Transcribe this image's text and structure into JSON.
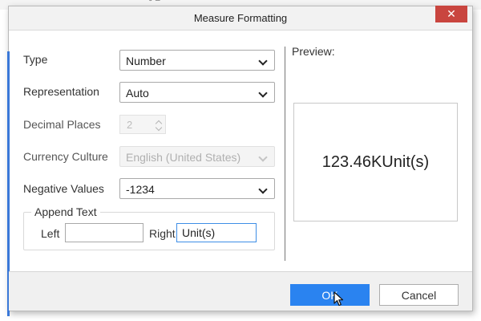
{
  "background": {
    "glyph": "˘ ‾"
  },
  "dialog": {
    "title": "Measure Formatting",
    "close_glyph": "✕"
  },
  "form": {
    "type": {
      "label": "Type",
      "value": "Number"
    },
    "representation": {
      "label": "Representation",
      "value": "Auto"
    },
    "decimal_places": {
      "label": "Decimal Places",
      "value": "2"
    },
    "currency_culture": {
      "label": "Currency Culture",
      "value": "English (United States)"
    },
    "negative_values": {
      "label": "Negative Values",
      "value": "-1234"
    },
    "append_text": {
      "title": "Append Text",
      "left_label": "Left",
      "left_value": "",
      "right_label": "Right",
      "right_value": "Unit(s)"
    }
  },
  "preview": {
    "label": "Preview:",
    "value": "123.46KUnit(s)"
  },
  "footer": {
    "ok_label": "OK",
    "cancel_label": "Cancel"
  },
  "colors": {
    "accent": "#2a83f0",
    "close": "#c9453f",
    "side_accent": "#3a78d8"
  },
  "icons": [
    "close-icon",
    "chevron-down-icon",
    "spin-up-icon",
    "spin-down-icon",
    "cursor-pointer-icon"
  ]
}
